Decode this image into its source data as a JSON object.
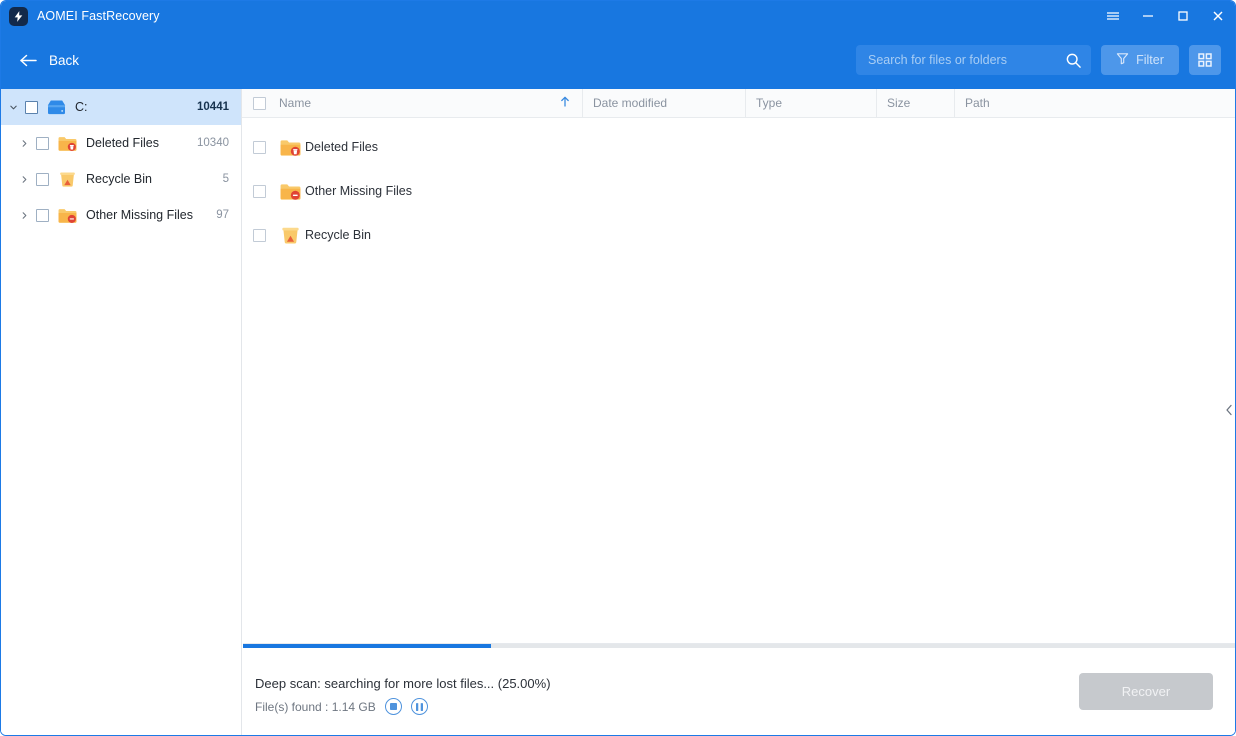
{
  "window": {
    "app_title": "AOMEI FastRecovery",
    "logo_icon": "lightning-bolt-logo",
    "controls": [
      {
        "name": "menu",
        "icon": "hamburger-menu-icon"
      },
      {
        "name": "minimize",
        "icon": "minimize-icon"
      },
      {
        "name": "maximize",
        "icon": "maximize-icon"
      },
      {
        "name": "close",
        "icon": "close-icon"
      }
    ]
  },
  "toolbar": {
    "back_label": "Back",
    "back_icon": "arrow-left-icon",
    "search": {
      "placeholder": "Search for files or folders",
      "value": "",
      "icon": "search-icon"
    },
    "filter_label": "Filter",
    "filter_icon": "funnel-icon",
    "grid_view_icon": "grid-view-icon"
  },
  "sidebar": {
    "items": [
      {
        "label": "C:",
        "count": "10441",
        "icon": "disk-drive-icon",
        "level": 0,
        "expanded": true,
        "selected": true
      },
      {
        "label": "Deleted Files",
        "count": "10340",
        "icon": "folder-deleted-icon",
        "level": 1,
        "expanded": false,
        "selected": false
      },
      {
        "label": "Recycle Bin",
        "count": "5",
        "icon": "recycle-bin-icon",
        "level": 1,
        "expanded": false,
        "selected": false
      },
      {
        "label": "Other Missing Files",
        "count": "97",
        "icon": "folder-missing-icon",
        "level": 1,
        "expanded": false,
        "selected": false
      }
    ]
  },
  "file_list": {
    "columns": [
      {
        "key": "name",
        "label": "Name",
        "sorted": "asc"
      },
      {
        "key": "date",
        "label": "Date modified"
      },
      {
        "key": "type",
        "label": "Type"
      },
      {
        "key": "size",
        "label": "Size"
      },
      {
        "key": "path",
        "label": "Path"
      }
    ],
    "sort_icon": "sort-ascending-icon",
    "rows": [
      {
        "name": "Deleted Files",
        "icon": "folder-deleted-icon",
        "date": "",
        "type": "",
        "size": "",
        "path": ""
      },
      {
        "name": "Other Missing Files",
        "icon": "folder-missing-icon",
        "date": "",
        "type": "",
        "size": "",
        "path": ""
      },
      {
        "name": "Recycle Bin",
        "icon": "recycle-bin-icon",
        "date": "",
        "type": "",
        "size": "",
        "path": ""
      }
    ],
    "collapse_icon": "chevron-left-icon"
  },
  "status": {
    "progress_percent": 25,
    "message": "Deep scan: searching for more lost files... (25.00%)",
    "files_found": "File(s) found : 1.14 GB",
    "stop_icon": "stop-icon",
    "pause_icon": "pause-icon",
    "recover_label": "Recover"
  },
  "colors": {
    "brand_blue": "#1877e0",
    "selection_blue": "#cfe4fb",
    "folder_orange": "#f7b84e",
    "badge_red": "#e04434",
    "disabled_gray": "#c6c9cd"
  }
}
